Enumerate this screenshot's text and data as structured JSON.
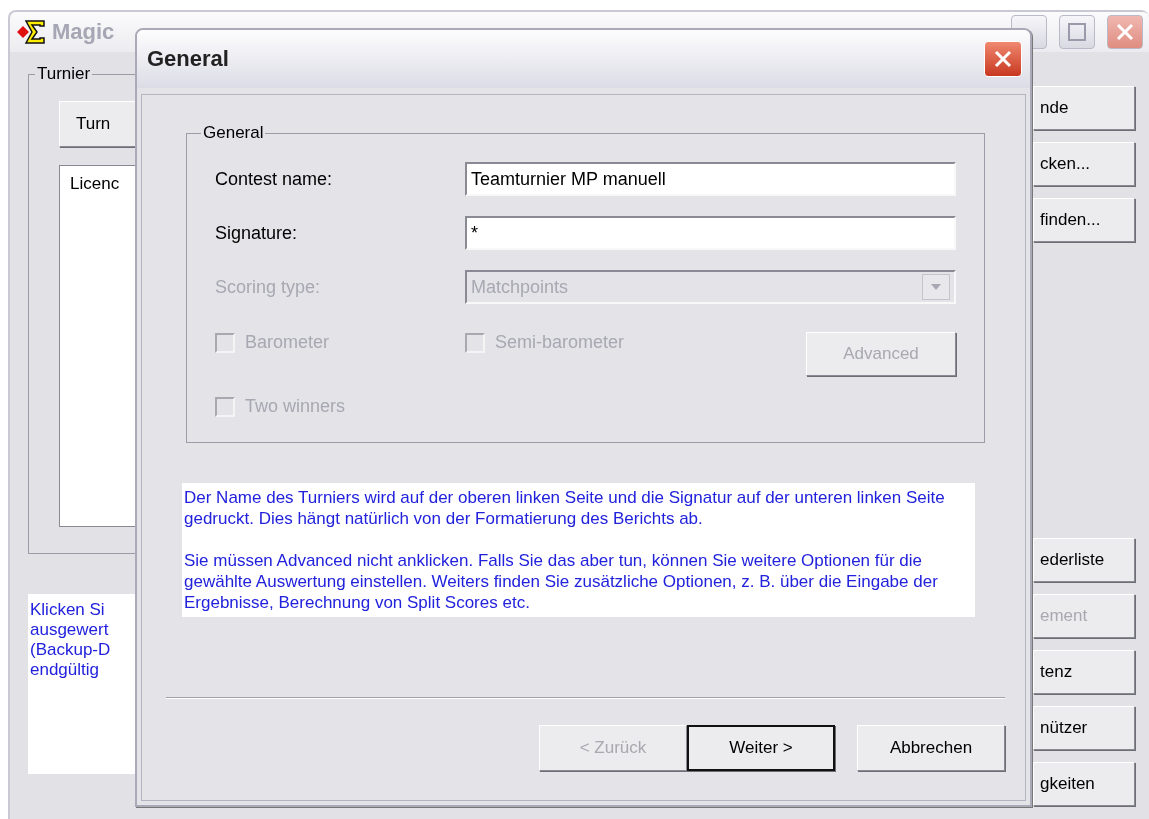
{
  "main_window": {
    "title": "Magic",
    "group": {
      "label": "Turnier",
      "button": "Turn",
      "list_item": "Licenc"
    },
    "info_lines": [
      "Klicken Si",
      "ausgewert",
      "(Backup-D",
      "endgültig"
    ],
    "side_buttons_top": [
      {
        "label": "nde",
        "disabled": false
      },
      {
        "label": "cken...",
        "disabled": false
      },
      {
        "label": "finden...",
        "disabled": false
      }
    ],
    "side_buttons_bottom": [
      {
        "label": "ederliste",
        "disabled": false
      },
      {
        "label": "ement",
        "disabled": true
      },
      {
        "label": "tenz",
        "disabled": false
      },
      {
        "label": "nützer",
        "disabled": false
      },
      {
        "label": "gkeiten",
        "disabled": false
      }
    ]
  },
  "dialog": {
    "title": "General",
    "group_label": "General",
    "fields": [
      {
        "kind": "text",
        "label": "Contest name:",
        "value": "Teamturnier MP manuell",
        "disabled": false
      },
      {
        "kind": "text",
        "label": "Signature:",
        "value": "*",
        "disabled": false
      },
      {
        "kind": "dropdown",
        "label": "Scoring type:",
        "value": "Matchpoints",
        "disabled": true
      }
    ],
    "checkboxes": [
      {
        "label": "Barometer",
        "checked": false,
        "disabled": true
      },
      {
        "label": "Semi-barometer",
        "checked": false,
        "disabled": true
      },
      {
        "label": "Two winners",
        "checked": false,
        "disabled": true
      }
    ],
    "advanced_button": {
      "label": "Advanced",
      "disabled": true
    },
    "help_paragraphs": [
      "Der Name des Turniers wird auf der oberen linken Seite und die Signatur auf der unteren linken Seite gedruckt. Dies hängt natürlich von der Formatierung des Berichts ab.",
      "Sie müssen Advanced nicht anklicken. Falls Sie das aber tun, können Sie weitere Optionen für die gewählte Auswertung einstellen. Weiters finden Sie zusätzliche Optionen, z. B. über die Eingabe der Ergebnisse, Berechnung von Split Scores etc."
    ],
    "buttons": [
      {
        "label": "< Zurück",
        "disabled": true,
        "default": false
      },
      {
        "label": "Weiter >",
        "disabled": false,
        "default": true
      },
      {
        "label": "Abbrechen",
        "disabled": false,
        "default": false
      }
    ]
  }
}
